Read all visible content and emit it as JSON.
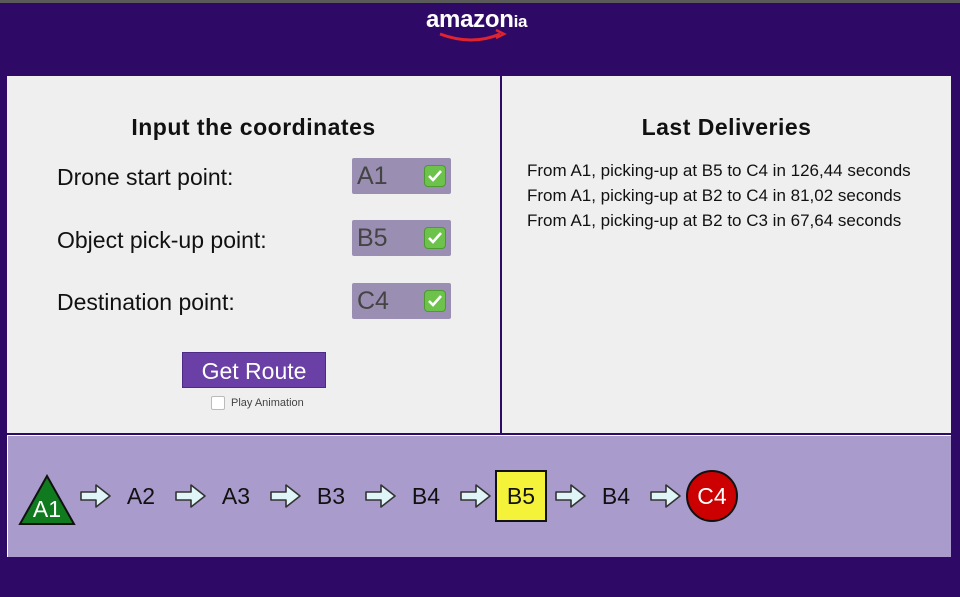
{
  "brand": {
    "logo_main": "amazo",
    "logo_n": "n",
    "logo_suffix": "ia"
  },
  "form": {
    "title": "Input the coordinates",
    "fields": [
      {
        "label": "Drone start point:",
        "value": "A1"
      },
      {
        "label": "Object pick-up point:",
        "value": "B5"
      },
      {
        "label": "Destination point:",
        "value": "C4"
      }
    ],
    "button_label": "Get Route",
    "checkbox_label": "Play Animation"
  },
  "deliveries": {
    "title": "Last Deliveries",
    "items": [
      "From A1, picking-up at B5 to C4 in 126,44 seconds",
      "From A1, picking-up at B2 to C4 in 81,02 seconds",
      "From A1, picking-up at B2 to C3 in 67,64 seconds"
    ]
  },
  "route": {
    "nodes": [
      "A1",
      "A2",
      "A3",
      "B3",
      "B4",
      "B5",
      "B4",
      "C4"
    ]
  },
  "colors": {
    "background": "#2e0a66",
    "panel": "#efefef",
    "route_panel": "#a99bcc",
    "button": "#6a3fa6",
    "start_node": "#0f7a1e",
    "pickup_node": "#f5f23a",
    "destination_node": "#cc0000"
  }
}
